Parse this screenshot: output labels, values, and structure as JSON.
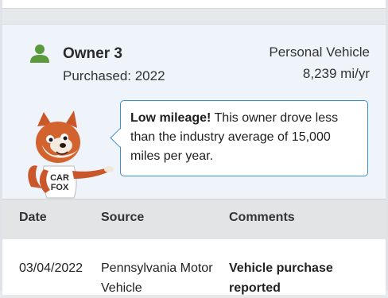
{
  "owner": {
    "title": "Owner 3",
    "purchased": "Purchased: 2022",
    "vehicle_type": "Personal Vehicle",
    "mileage": "8,239 mi/yr",
    "icon": "person-icon",
    "icon_color": "#5a9a3c"
  },
  "callout": {
    "bold": "Low mileage!",
    "text": " This owner drove less than the industry average of 15,000 miles per year.",
    "border_color": "#3b8fd6"
  },
  "mascot": {
    "shirt_text_1": "CAR",
    "shirt_text_2": "FOX"
  },
  "table": {
    "headers": [
      "Date",
      "Source",
      "Comments"
    ],
    "rows": [
      {
        "date": "03/04/2022",
        "source": "Pennsylvania Motor Vehicle",
        "comment": "Vehicle purchase reported"
      }
    ]
  }
}
